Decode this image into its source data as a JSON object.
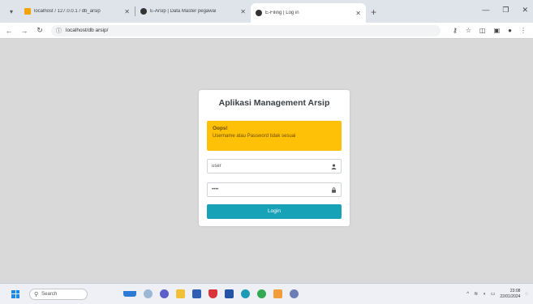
{
  "browser": {
    "tabs": [
      {
        "title": "localhost / 127.0.0.1 / db_arsip",
        "active": false,
        "favicon_color": "#f4a300"
      },
      {
        "title": "E-Arsip | Data Master pegawai",
        "active": false,
        "favicon_color": "#333333"
      },
      {
        "title": "E-Filing | Log in",
        "active": true,
        "favicon_color": "#333333"
      }
    ],
    "new_tab_label": "+",
    "address": "localhost/db arsip/"
  },
  "login": {
    "title": "Aplikasi Management Arsip",
    "alert": {
      "title": "Oops!",
      "message": "Username atau Password tidak sesuai",
      "color": "#ffc107"
    },
    "username_value": "user",
    "password_value": "••••",
    "button_label": "Login",
    "button_color": "#17a2b8"
  },
  "taskbar": {
    "search_label": "Search",
    "time": "23:08",
    "date": "22/01/2024"
  }
}
